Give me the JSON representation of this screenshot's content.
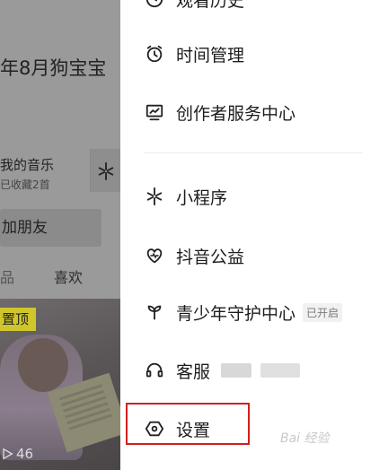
{
  "background_page": {
    "title": "年8月狗宝宝",
    "music_title": "我的音乐",
    "music_subtitle": "已收藏2首",
    "add_friend": "加朋友",
    "tab_left": "品",
    "tab_likes": "喜欢",
    "pinned_badge": "置顶",
    "view_count": "46"
  },
  "menu": {
    "partial_top": "观看历史",
    "time_management": "时间管理",
    "creator_center": "创作者服务中心",
    "mini_programs": "小程序",
    "charity": "抖音公益",
    "youth_protection": "青少年守护中心",
    "youth_status": "已开启",
    "customer_service": "客服",
    "settings": "设置"
  },
  "watermark": "Bai 经验",
  "colors": {
    "highlight_border": "#d21f1f",
    "badge": "#cfc62b"
  }
}
